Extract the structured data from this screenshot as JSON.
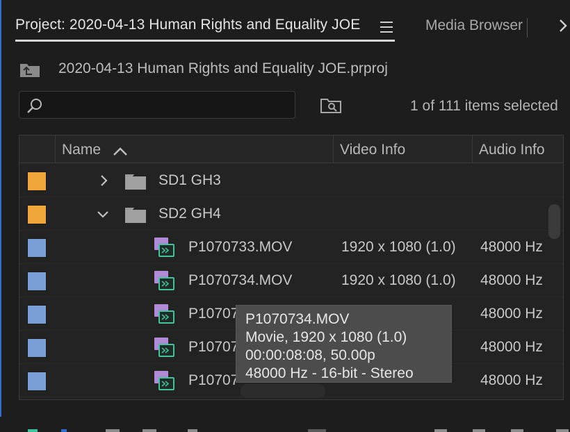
{
  "tabs": {
    "project_label": "Project: 2020-04-13 Human Rights and Equality JOE",
    "media_browser_label": "Media Browser",
    "overflow_icon": "chevron-right-icon",
    "menu_icon": "hamburger-menu-icon"
  },
  "project": {
    "file_name": "2020-04-13 Human Rights and Equality JOE.prproj",
    "icon": "project-folder-up-icon"
  },
  "search": {
    "value": "",
    "placeholder": "",
    "icon": "search-icon",
    "find_icon": "find-bin-icon"
  },
  "status": {
    "selection": "1 of 111 items selected"
  },
  "columns": {
    "name": "Name",
    "video_info": "Video Info",
    "audio_info": "Audio Info",
    "sort": "ascending"
  },
  "colors": {
    "bin_label": "#f0a53a",
    "clip_label": "#7a9fd6",
    "clip_icon_purple": "#b08ad8",
    "clip_icon_green": "#3ec39a",
    "accent": "#2f6fd0"
  },
  "rows": [
    {
      "type": "bin",
      "label": "SD1 GH3",
      "expanded": false
    },
    {
      "type": "bin",
      "label": "SD2 GH4",
      "expanded": true
    },
    {
      "type": "clip",
      "name": "P1070733.MOV",
      "video": "1920 x 1080 (1.0)",
      "audio": "48000 Hz"
    },
    {
      "type": "clip",
      "name": "P1070734.MOV",
      "video": "1920 x 1080 (1.0)",
      "audio": "48000 Hz"
    },
    {
      "type": "clip",
      "name": "P10707",
      "video": "",
      "audio": "48000 Hz"
    },
    {
      "type": "clip",
      "name": "P10707",
      "video": "",
      "audio": "48000 Hz"
    },
    {
      "type": "clip",
      "name": "P10707",
      "video": "",
      "audio": "48000 Hz"
    }
  ],
  "tooltip": {
    "line1": "P1070734.MOV",
    "line2": "Movie, 1920 x 1080 (1.0)",
    "line3": "00:00:08:08, 50.00p",
    "line4": "48000 Hz - 16-bit - Stereo"
  }
}
